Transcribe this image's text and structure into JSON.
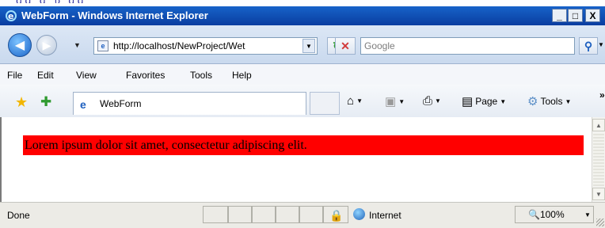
{
  "window": {
    "title": "WebForm - Windows Internet Explorer",
    "controls": [
      "_",
      "□",
      "X"
    ]
  },
  "navigation": {
    "address_url": "http://localhost/NewProject/Wet",
    "search_placeholder": "Google"
  },
  "menu": [
    "File",
    "Edit",
    "View",
    "Favorites",
    "Tools",
    "Help"
  ],
  "favorites_bar": {
    "tab_title": "WebForm",
    "tools": [
      "Page",
      "Tools"
    ]
  },
  "content": {
    "text": "Lorem ipsum dolor sit amet, consectetur adipiscing elit.",
    "background_color": "#ff0000"
  },
  "status_bar": {
    "status": "Done",
    "zone": "Internet",
    "zoom": "100%"
  },
  "icons": {
    "ie_logo": "internet-explorer-icon",
    "back": "back-arrow-icon",
    "forward": "forward-arrow-icon",
    "refresh": "refresh-icon",
    "stop": "stop-icon",
    "search": "search-icon",
    "favorites": "favorites-star-icon",
    "add_favorites": "add-favorites-icon",
    "home": "home-icon",
    "feeds": "rss-feed-icon",
    "print": "print-icon",
    "page": "page-icon",
    "tools": "gear-icon",
    "protected_mode": "lock-icon",
    "globe": "globe-icon",
    "zoom": "magnifier-icon"
  }
}
